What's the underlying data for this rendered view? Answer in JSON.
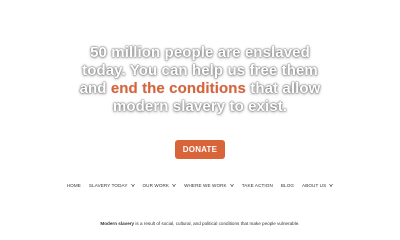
{
  "hero": {
    "line1": "50 million people are enslaved",
    "line2": "today. You can help us free them",
    "line3_pre": "and ",
    "line3_accent": "end the conditions",
    "line3_post": " that allow",
    "line4": "modern slavery to exist."
  },
  "donate": {
    "label": "DONATE"
  },
  "nav": {
    "items": [
      {
        "label": "HOME",
        "has_dropdown": false
      },
      {
        "label": "SLAVERY TODAY",
        "has_dropdown": true
      },
      {
        "label": "OUR WORK",
        "has_dropdown": true
      },
      {
        "label": "WHERE WE WORK",
        "has_dropdown": true
      },
      {
        "label": "TAKE ACTION",
        "has_dropdown": false
      },
      {
        "label": "BLOG",
        "has_dropdown": false
      },
      {
        "label": "ABOUT US",
        "has_dropdown": true
      }
    ],
    "dropdown_icon": "chevron-down-icon"
  },
  "footer": {
    "bold": "Modern slavery",
    "rest": " is a result of social, cultural, and political conditions that make people vulnerable."
  },
  "colors": {
    "accent": "#d9643a",
    "text": "#333333",
    "background": "#ffffff"
  }
}
